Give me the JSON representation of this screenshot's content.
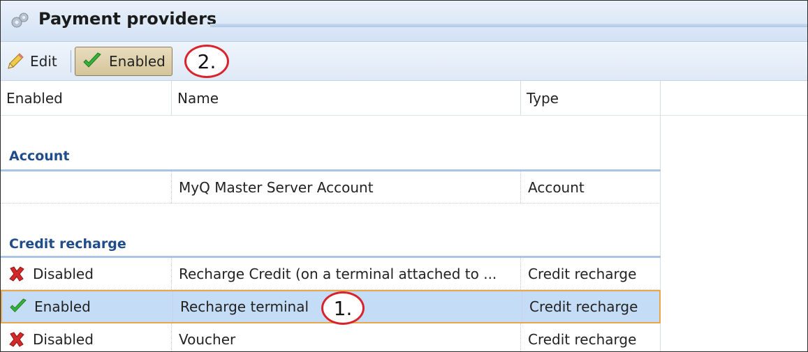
{
  "window": {
    "title": "Payment providers"
  },
  "toolbar": {
    "edit_label": "Edit",
    "enabled_label": "Enabled"
  },
  "annotations": {
    "one": "1.",
    "two": "2."
  },
  "columns": {
    "enabled": "Enabled",
    "name": "Name",
    "type": "Type"
  },
  "groups": [
    {
      "label": "Account",
      "rows": [
        {
          "status": "",
          "name": "MyQ Master Server Account",
          "type": "Account"
        }
      ]
    },
    {
      "label": "Credit recharge",
      "rows": [
        {
          "status": "Disabled",
          "status_icon": "red-x-icon",
          "name": "Recharge Credit (on a terminal attached to ...",
          "type": "Credit recharge"
        },
        {
          "status": "Enabled",
          "status_icon": "green-check-icon",
          "name": "Recharge terminal",
          "type": "Credit recharge",
          "selected": true
        },
        {
          "status": "Disabled",
          "status_icon": "red-x-icon",
          "name": "Voucher",
          "type": "Credit recharge"
        }
      ]
    }
  ],
  "colors": {
    "group_label": "#1f4c8a",
    "selection": "#c5dcf7",
    "selection_border": "#e8a84a",
    "annotation": "#d9232b"
  }
}
